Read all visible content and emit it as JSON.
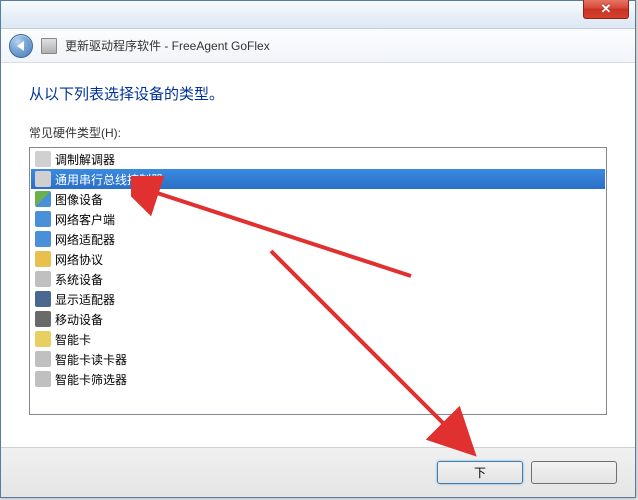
{
  "window": {
    "title": "更新驱动程序软件 - FreeAgent GoFlex"
  },
  "heading": "从以下列表选择设备的类型。",
  "list_label": "常见硬件类型(H):",
  "device_types": [
    {
      "label": "调制解调器",
      "icon": "modem-icon",
      "selected": false
    },
    {
      "label": "通用串行总线控制器",
      "icon": "usb-icon",
      "selected": true
    },
    {
      "label": "图像设备",
      "icon": "image-device-icon",
      "selected": false
    },
    {
      "label": "网络客户端",
      "icon": "network-client-icon",
      "selected": false
    },
    {
      "label": "网络适配器",
      "icon": "network-adapter-icon",
      "selected": false
    },
    {
      "label": "网络协议",
      "icon": "network-protocol-icon",
      "selected": false
    },
    {
      "label": "系统设备",
      "icon": "system-device-icon",
      "selected": false
    },
    {
      "label": "显示适配器",
      "icon": "display-adapter-icon",
      "selected": false
    },
    {
      "label": "移动设备",
      "icon": "mobile-device-icon",
      "selected": false
    },
    {
      "label": "智能卡",
      "icon": "smartcard-icon",
      "selected": false
    },
    {
      "label": "智能卡读卡器",
      "icon": "smartcard-reader-icon",
      "selected": false
    },
    {
      "label": "智能卡筛选器",
      "icon": "smartcard-filter-icon",
      "selected": false
    }
  ],
  "buttons": {
    "next": "下",
    "cancel": ""
  }
}
